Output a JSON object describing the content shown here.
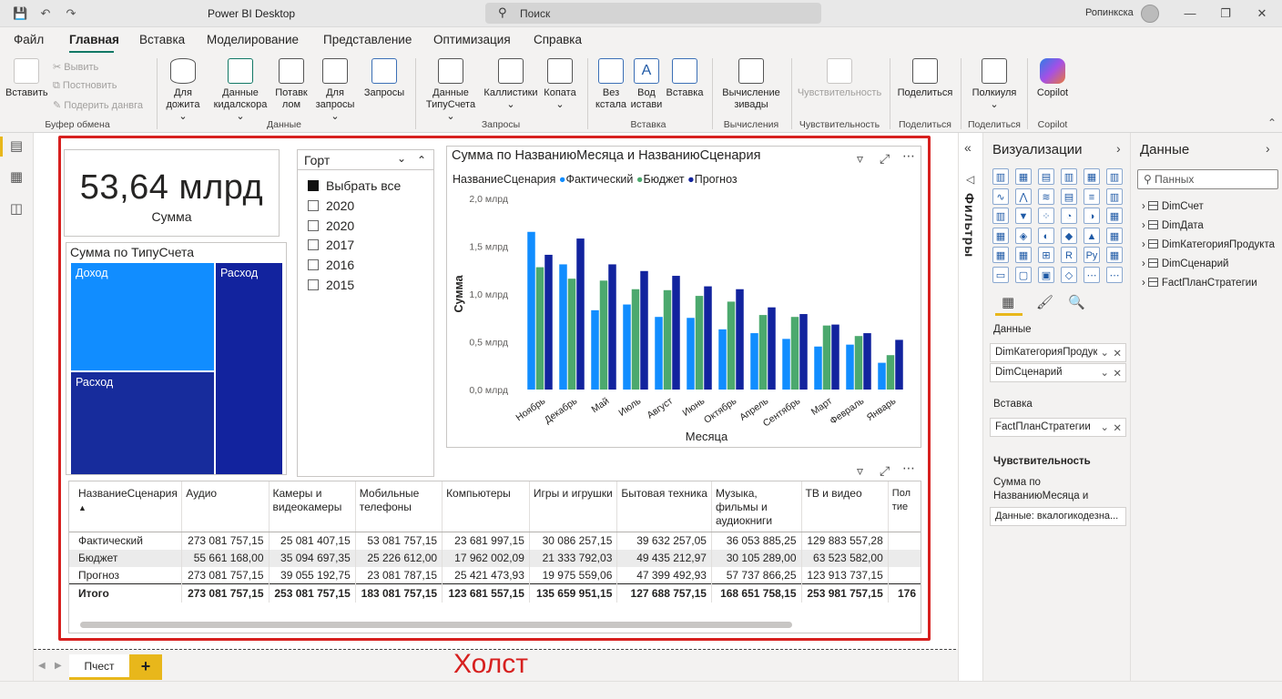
{
  "window": {
    "title": "Power BI Desktop",
    "search_placeholder": "Поиск",
    "user": "Ропинкска"
  },
  "menu": [
    "Файл",
    "Главная",
    "Вставка",
    "Моделирование",
    "Представление",
    "Оптимизация",
    "Справка"
  ],
  "ribbon": {
    "paste": "Вставить",
    "cut": "Вывить",
    "copy": "Постновить",
    "format_painter": "Подерить данвга",
    "group_clipboard": "Буфер обмена",
    "get_data_l1": "Для",
    "get_data_l2": "дожита",
    "excel_l1": "Данные",
    "excel_l2": "кидалскора",
    "onelake_l1": "Потавк",
    "onelake_l2": "лом",
    "sql_l1": "Для",
    "sql_l2": "запросы",
    "recent": "Запросы",
    "group_data": "Данные",
    "transform_l1": "Данные",
    "transform_l2": "ТипуСчета",
    "columns": "Каллистики",
    "refresh": "Копата",
    "group_queries": "Запросы",
    "visual_l1": "Вез",
    "visual_l2": "кстала",
    "textbox_l1": "Вод",
    "textbox_l2": "истави",
    "more_visuals": "Вставка",
    "group_insert": "Вставка",
    "calc_l1": "Вычисление",
    "calc_l2": "зивады",
    "group_calc": "Вычисления",
    "sensitivity": "Чувствительность",
    "group_sensitivity": "Чувствительность",
    "share": "Поделиться",
    "group_share": "Поделиться",
    "comments": "Полкиуля",
    "group_share2": "Поделиться",
    "copilot": "Copilot",
    "group_copilot": "Copilot"
  },
  "card": {
    "value": "53,64 млрд",
    "label": "Сумма"
  },
  "treemap": {
    "title": "Сумма по ТипуСчета",
    "tiles": [
      "Доход",
      "Расход",
      "Расход"
    ],
    "colors": [
      "#118dff",
      "#12239e",
      "#0d1d8c"
    ]
  },
  "slicer": {
    "title": "Горт",
    "items": [
      {
        "label": "Выбрать все",
        "checked": true
      },
      {
        "label": "2020",
        "checked": false
      },
      {
        "label": "2020",
        "checked": false
      },
      {
        "label": "2017",
        "checked": false
      },
      {
        "label": "2016",
        "checked": false
      },
      {
        "label": "2015",
        "checked": false
      }
    ]
  },
  "chart_data": {
    "type": "bar",
    "title": "Сумма по НазваниюМесяца и НазваниюСценария",
    "legend_title": "НазваниеСценария",
    "xlabel": "Месяца",
    "ylabel": "Сумма",
    "ylim": [
      0,
      2.0
    ],
    "y_ticks": [
      "0,0 млрд",
      "0,5 млрд",
      "1,0 млрд",
      "1,5 млрд",
      "2,0 млрд"
    ],
    "categories": [
      "Ноябрь",
      "Декабрь",
      "Май",
      "Июль",
      "Август",
      "Июнь",
      "Октябрь",
      "Апрель",
      "Сентябрь",
      "Март",
      "Февраль",
      "Январь"
    ],
    "series": [
      {
        "name": "Фактический",
        "color": "#118dff",
        "values": [
          1.65,
          1.31,
          0.83,
          0.89,
          0.76,
          0.75,
          0.63,
          0.59,
          0.53,
          0.45,
          0.47,
          0.28
        ]
      },
      {
        "name": "Бюджет",
        "color": "#4ca96e",
        "values": [
          1.28,
          1.16,
          1.14,
          1.05,
          1.04,
          0.98,
          0.92,
          0.78,
          0.76,
          0.67,
          0.56,
          0.36
        ]
      },
      {
        "name": "Прогноз",
        "color": "#12239e",
        "values": [
          1.41,
          1.58,
          1.31,
          1.24,
          1.19,
          1.08,
          1.05,
          0.86,
          0.79,
          0.68,
          0.59,
          0.52
        ]
      }
    ],
    "grid": false,
    "legend_position": "top-left"
  },
  "matrix": {
    "headers": [
      "НазваниеСценария",
      "Аудио",
      "Камеры и видеокамеры",
      "Мобильные телефоны",
      "Компьютеры",
      "Игры и игрушки",
      "Бытовая техника",
      "Музыка, фильмы и аудиокниги",
      "ТВ и видео",
      "Пол тие"
    ],
    "rows": [
      {
        "label": "Фактический",
        "values": [
          "273 081 757,15",
          "25 081 407,15",
          "53 081 757,15",
          "23 681 997,15",
          "30 086 257,15",
          "39 632 257,05",
          "36 053 885,25",
          "129 883 557,28",
          ""
        ]
      },
      {
        "label": "Бюджет",
        "values": [
          "55 661 168,00",
          "35 094 697,35",
          "25 226 612,00",
          "17 962 002,09",
          "21 333 792,03",
          "49 435 212,97",
          "30 105 289,00",
          "63 523 582,00",
          ""
        ]
      },
      {
        "label": "Прогноз",
        "values": [
          "273 081 757,15",
          "39 055 192,75",
          "23 081 787,15",
          "25 421 473,93",
          "19 975 559,06",
          "47 399 492,93",
          "57 737 866,25",
          "123 913 737,15",
          ""
        ]
      }
    ],
    "total": {
      "label": "Итого",
      "values": [
        "273 081 757,15",
        "253 081 757,15",
        "183 081 757,15",
        "123 681 557,15",
        "135 659 951,15",
        "127 688 757,15",
        "168 651 758,15",
        "253 981 757,15",
        "176"
      ]
    }
  },
  "pages": {
    "tab": "Пчест",
    "add": "+"
  },
  "canvas_label": "Холст",
  "filters_pane": {
    "label": "Фильтры"
  },
  "visualizations_pane": {
    "title": "Визуализации",
    "data_label": "Данные",
    "fields": [
      "DimКатегорияПродукта",
      "DimСценарий"
    ],
    "insert_label": "Вставка",
    "insert_fields": [
      "FactПланСтратегии"
    ],
    "sensitivity_label": "Чувствительность",
    "tooltip_l1": "Сумма по",
    "tooltip_l2": "НазваниюМесяца и",
    "tooltip_box": "Данные: вкалогикодезна..."
  },
  "data_pane": {
    "title": "Данные",
    "search_placeholder": "Панных",
    "tables": [
      "DimСчет",
      "DimДата",
      "DimКатегорияПродукта",
      "DimСценарий",
      "FactПланСтратегии"
    ]
  }
}
